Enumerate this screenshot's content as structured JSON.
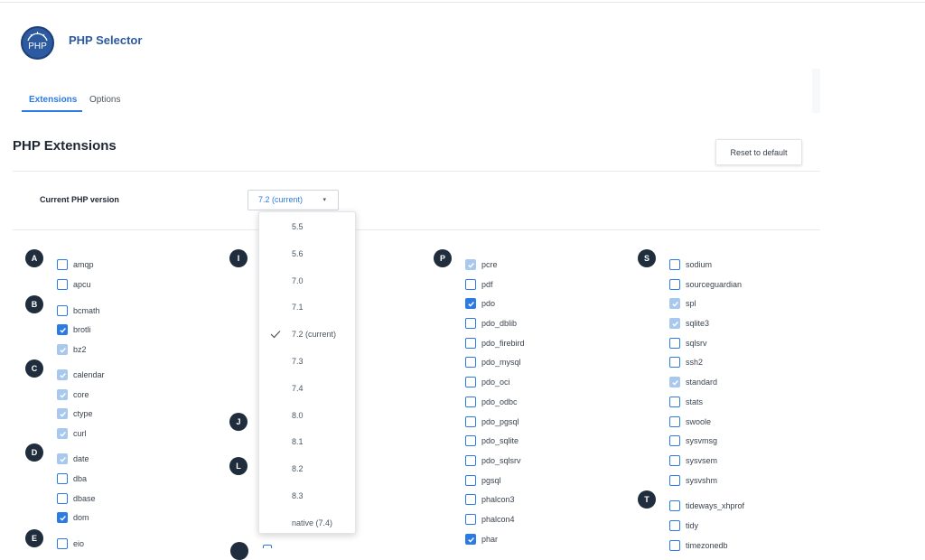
{
  "app": {
    "title": "PHP Selector",
    "logo_text": "PHP"
  },
  "tabs": [
    {
      "label": "Extensions",
      "active": true
    },
    {
      "label": "Options",
      "active": false
    }
  ],
  "section": {
    "title": "PHP Extensions",
    "reset_label": "Reset to default"
  },
  "version": {
    "label": "Current PHP version",
    "selected": "7.2 (current)",
    "caret": "▾"
  },
  "dropdown": {
    "options": [
      {
        "label": "5.5",
        "selected": false
      },
      {
        "label": "5.6",
        "selected": false
      },
      {
        "label": "7.0",
        "selected": false
      },
      {
        "label": "7.1",
        "selected": false
      },
      {
        "label": "7.2 (current)",
        "selected": true
      },
      {
        "label": "7.3",
        "selected": false
      },
      {
        "label": "7.4",
        "selected": false
      },
      {
        "label": "8.0",
        "selected": false
      },
      {
        "label": "8.1",
        "selected": false
      },
      {
        "label": "8.2",
        "selected": false
      },
      {
        "label": "8.3",
        "selected": false
      },
      {
        "label": "native (7.4)",
        "selected": false
      }
    ]
  },
  "letters": [
    "A",
    "B",
    "C",
    "D",
    "E",
    "I",
    "J",
    "L",
    "P",
    "S",
    "T"
  ],
  "extensions": [
    {
      "name": "amqp",
      "state": "unchecked"
    },
    {
      "name": "apcu",
      "state": "unchecked"
    },
    {
      "name": "bcmath",
      "state": "unchecked"
    },
    {
      "name": "brotli",
      "state": "checked"
    },
    {
      "name": "bz2",
      "state": "disabled"
    },
    {
      "name": "calendar",
      "state": "disabled"
    },
    {
      "name": "core",
      "state": "disabled"
    },
    {
      "name": "ctype",
      "state": "disabled"
    },
    {
      "name": "curl",
      "state": "disabled"
    },
    {
      "name": "date",
      "state": "disabled"
    },
    {
      "name": "dba",
      "state": "unchecked"
    },
    {
      "name": "dbase",
      "state": "unchecked"
    },
    {
      "name": "dom",
      "state": "checked"
    },
    {
      "name": "eio",
      "state": "unchecked"
    },
    {
      "name": "pcre",
      "state": "disabled"
    },
    {
      "name": "pdf",
      "state": "unchecked"
    },
    {
      "name": "pdo",
      "state": "checked"
    },
    {
      "name": "pdo_dblib",
      "state": "unchecked"
    },
    {
      "name": "pdo_firebird",
      "state": "unchecked"
    },
    {
      "name": "pdo_mysql",
      "state": "unchecked"
    },
    {
      "name": "pdo_oci",
      "state": "unchecked"
    },
    {
      "name": "pdo_odbc",
      "state": "unchecked"
    },
    {
      "name": "pdo_pgsql",
      "state": "unchecked"
    },
    {
      "name": "pdo_sqlite",
      "state": "unchecked"
    },
    {
      "name": "pdo_sqlsrv",
      "state": "unchecked"
    },
    {
      "name": "pgsql",
      "state": "unchecked"
    },
    {
      "name": "phalcon3",
      "state": "unchecked"
    },
    {
      "name": "phalcon4",
      "state": "unchecked"
    },
    {
      "name": "phar",
      "state": "checked"
    },
    {
      "name": "sodium",
      "state": "unchecked"
    },
    {
      "name": "sourceguardian",
      "state": "unchecked"
    },
    {
      "name": "spl",
      "state": "disabled"
    },
    {
      "name": "sqlite3",
      "state": "disabled"
    },
    {
      "name": "sqlsrv",
      "state": "unchecked"
    },
    {
      "name": "ssh2",
      "state": "unchecked"
    },
    {
      "name": "standard",
      "state": "disabled"
    },
    {
      "name": "stats",
      "state": "unchecked"
    },
    {
      "name": "swoole",
      "state": "unchecked"
    },
    {
      "name": "sysvmsg",
      "state": "unchecked"
    },
    {
      "name": "sysvsem",
      "state": "unchecked"
    },
    {
      "name": "sysvshm",
      "state": "unchecked"
    },
    {
      "name": "tideways_xhprof",
      "state": "unchecked"
    },
    {
      "name": "tidy",
      "state": "unchecked"
    },
    {
      "name": "timezonedb",
      "state": "unchecked"
    }
  ],
  "colors": {
    "accent": "#2c7be5",
    "brand": "#2c5aa0",
    "letter_badge": "#1f2d3d",
    "disabled_check": "#a9c8ee"
  }
}
